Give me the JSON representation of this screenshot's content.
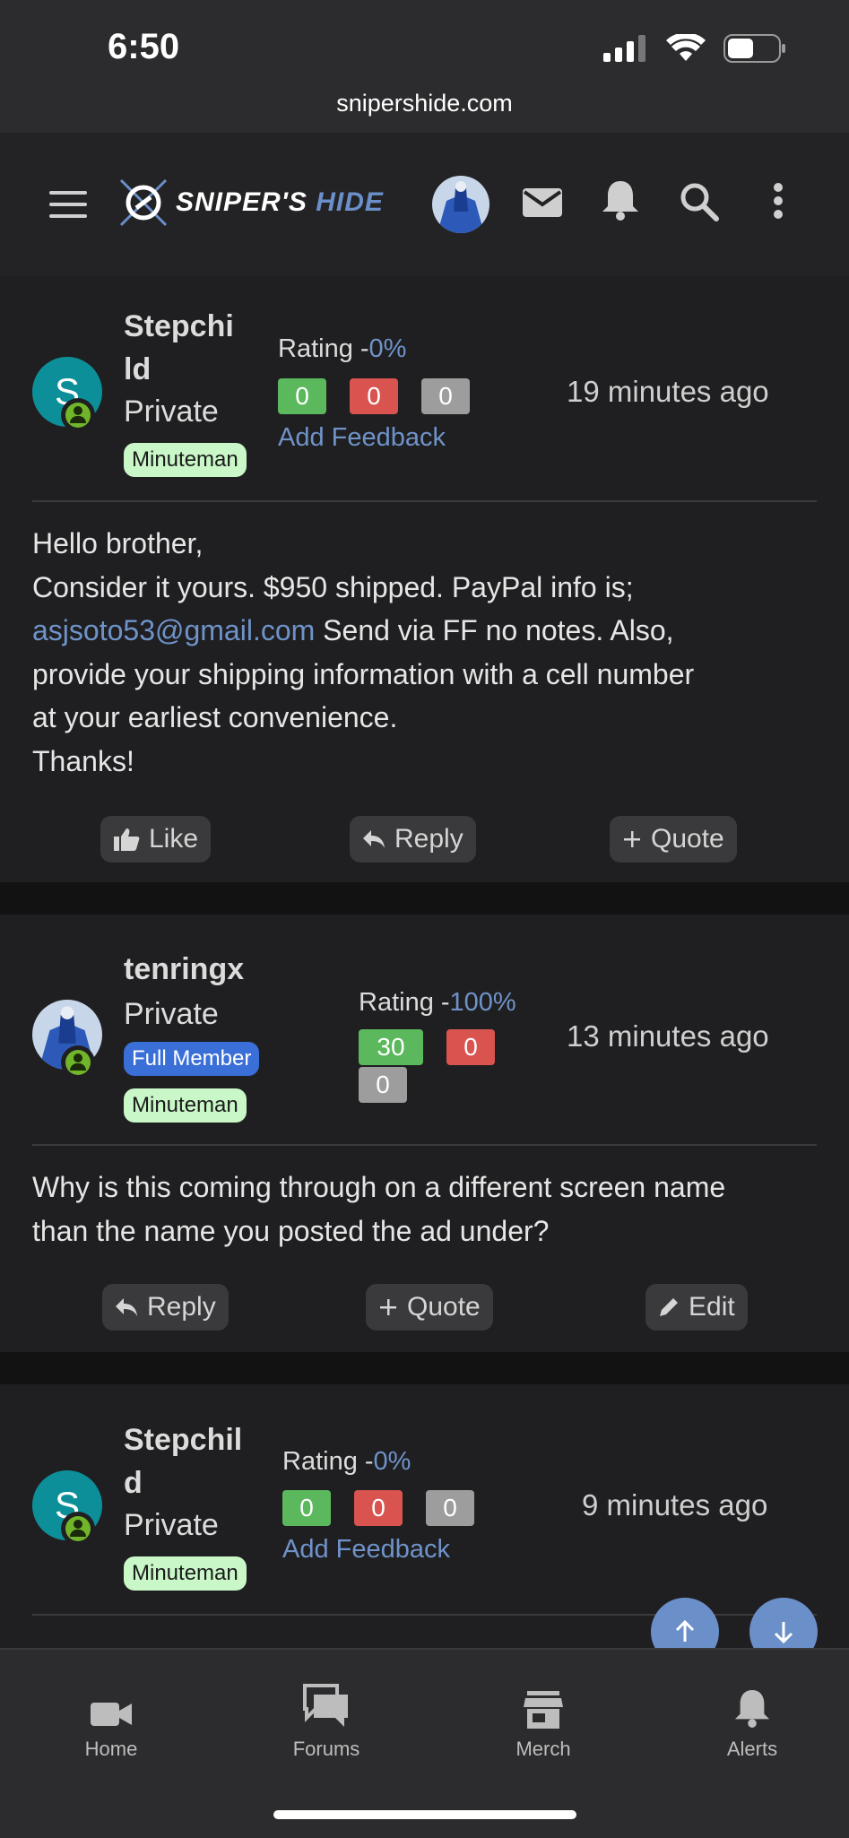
{
  "status": {
    "time": "6:50",
    "url": "snipershide.com"
  },
  "header": {
    "logo_part1": "SNIPER'S",
    "logo_part2": "HIDE"
  },
  "posts": [
    {
      "username_line1": "Stepchi",
      "username_line2": "ld",
      "rank": "Private",
      "badge": "Minuteman",
      "avatar_letter": "S",
      "rating_label": "Rating -",
      "rating_pct": "0%",
      "positive": "0",
      "negative": "0",
      "neutral": "0",
      "feedback": "Add Feedback",
      "time": "19 minutes ago",
      "body_line1": "Hello brother,",
      "body_line2": "Consider it yours. $950 shipped. PayPal info is;",
      "body_link": "asjsoto53@gmail.com",
      "body_line3_rest": " Send via FF no notes. Also,",
      "body_line4": "provide your shipping information with a cell number",
      "body_line5": "at your earliest convenience.",
      "body_line6": "Thanks!",
      "like": "Like",
      "reply": "Reply",
      "quote": "Quote"
    },
    {
      "username": "tenringx",
      "rank": "Private",
      "badge_full": "Full Member",
      "badge": "Minuteman",
      "rating_label": "Rating -",
      "rating_pct": "100%",
      "positive": "30",
      "negative": "0",
      "neutral": "0",
      "time": "13 minutes ago",
      "body_line1": "Why is this coming through on a different screen name",
      "body_line2": "than the name you posted the ad under?",
      "reply": "Reply",
      "quote": "Quote",
      "edit": "Edit"
    },
    {
      "username_line1": "Stepchil",
      "username_line2": "d",
      "rank": "Private",
      "badge": "Minuteman",
      "avatar_letter": "S",
      "rating_label": "Rating -",
      "rating_pct": "0%",
      "positive": "0",
      "negative": "0",
      "neutral": "0",
      "feedback": "Add Feedback",
      "time": "9 minutes ago"
    }
  ],
  "tabs": [
    {
      "label": "Home",
      "icon": "video-camera-icon"
    },
    {
      "label": "Forums",
      "icon": "chat-bubbles-icon"
    },
    {
      "label": "Merch",
      "icon": "store-icon"
    },
    {
      "label": "Alerts",
      "icon": "bell-icon"
    }
  ]
}
